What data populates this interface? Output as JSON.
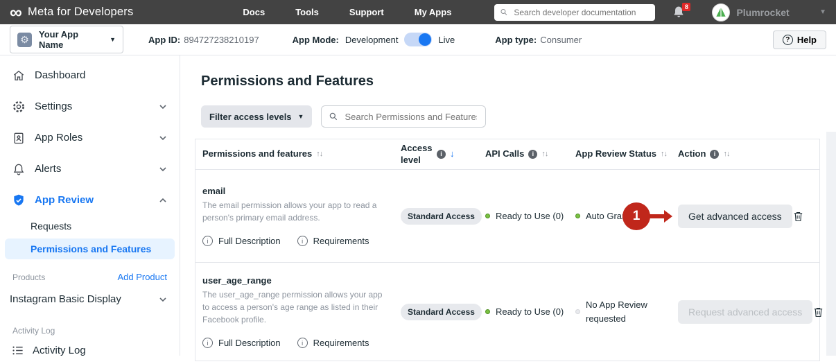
{
  "topbar": {
    "brand": "Meta for Developers",
    "nav": [
      "Docs",
      "Tools",
      "Support",
      "My Apps"
    ],
    "search_placeholder": "Search developer documentation",
    "notification_count": "8",
    "user_name": "Plumrocket"
  },
  "appbar": {
    "app_selector": "Your App Name",
    "app_id_label": "App ID:",
    "app_id": "894727238210197",
    "app_mode_label": "App Mode:",
    "app_mode_value": "Development",
    "toggle_right_label": "Live",
    "app_type_label": "App type:",
    "app_type_value": "Consumer",
    "help_label": "Help"
  },
  "sidebar": {
    "items": [
      {
        "label": "Dashboard",
        "icon": "home-icon",
        "expandable": false
      },
      {
        "label": "Settings",
        "icon": "gear-icon",
        "expandable": true
      },
      {
        "label": "App Roles",
        "icon": "id-badge-icon",
        "expandable": true
      },
      {
        "label": "Alerts",
        "icon": "bell-icon",
        "expandable": true
      },
      {
        "label": "App Review",
        "icon": "shield-check-icon",
        "expandable": true,
        "expanded": true,
        "active": true
      }
    ],
    "sub_items": [
      {
        "label": "Requests",
        "active": false
      },
      {
        "label": "Permissions and Features",
        "active": true
      }
    ],
    "products_label": "Products",
    "add_product": "Add Product",
    "product_items": [
      {
        "label": "Instagram Basic Display"
      }
    ],
    "activity_label": "Activity Log",
    "activity_item": "Activity Log"
  },
  "main": {
    "title": "Permissions and Features",
    "filter_button": "Filter access levels",
    "search_placeholder": "Search Permissions and Features",
    "annotation_label": "1",
    "table": {
      "columns": [
        {
          "label": "Permissions and features",
          "info": false,
          "sort": "both"
        },
        {
          "label": "Access level",
          "info": true,
          "sort": "down-active"
        },
        {
          "label": "API Calls",
          "info": true,
          "sort": "both"
        },
        {
          "label": "App Review Status",
          "info": false,
          "sort": "both"
        },
        {
          "label": "Action",
          "info": true,
          "sort": "both"
        }
      ],
      "rows": [
        {
          "name": "email",
          "description": "The email permission allows your app to read a person's primary email address.",
          "links": [
            "Full Description",
            "Requirements"
          ],
          "access_level": "Standard Access",
          "api_calls": "Ready to Use (0)",
          "api_calls_status_color": "#7ac143",
          "review_status": "Auto Granted",
          "review_status_color": "#7ac143",
          "action": "Get advanced access",
          "action_enabled": true
        },
        {
          "name": "user_age_range",
          "description": "The user_age_range permission allows your app to access a person's age range as listed in their Facebook profile.",
          "links": [
            "Full Description",
            "Requirements"
          ],
          "access_level": "Standard Access",
          "api_calls": "Ready to Use (0)",
          "api_calls_status_color": "#7ac143",
          "review_status": "No App Review requested",
          "review_status_color": "#d4d6da",
          "action": "Request advanced access",
          "action_enabled": false
        }
      ]
    }
  },
  "icons": {
    "meta_logo": "∞",
    "caret_down": "▼",
    "sort_both": "↑↓",
    "sort_down_active": "↓",
    "info_glyph": "i",
    "question_glyph": "?",
    "gear_glyph": "⚙"
  },
  "colors": {
    "topbar_bg": "#434343",
    "accent_blue": "#1877f2",
    "active_item_bg": "#e7f3ff",
    "annotation_red": "#c0271b",
    "status_green": "#7ac143",
    "notification_badge_red": "#e02828"
  }
}
